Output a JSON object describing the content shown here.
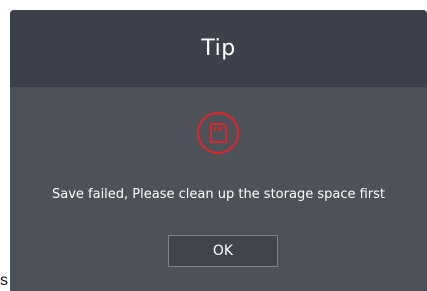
{
  "background": {
    "fragment_text": "s"
  },
  "dialog": {
    "title": "Tip",
    "icon": "storage-card-error-icon",
    "message": "Save failed, Please clean up the storage space first",
    "ok_label": "OK"
  },
  "colors": {
    "dialog_body": "#4d5158",
    "dialog_header": "#3d414b",
    "alert_red": "#d9272e",
    "button_border": "#7e838b",
    "text": "#ffffff"
  }
}
